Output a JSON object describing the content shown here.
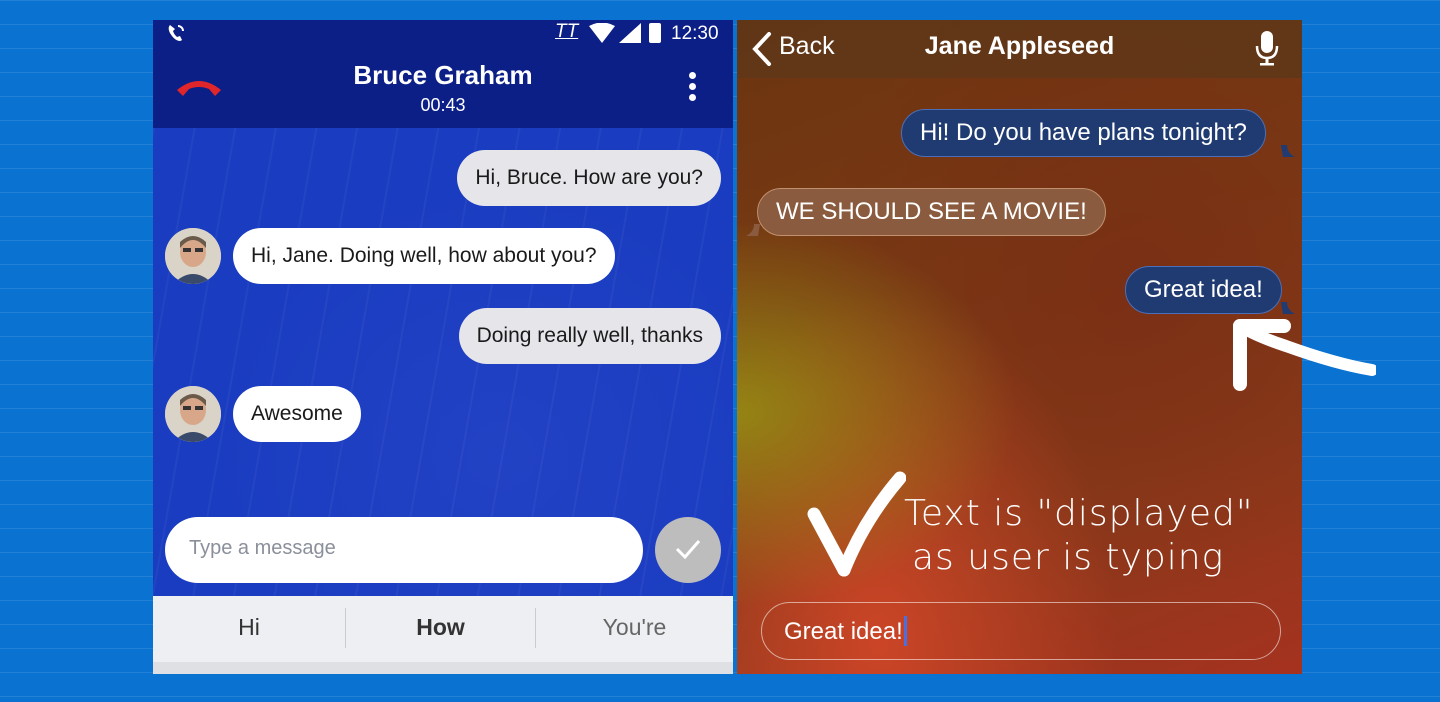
{
  "left_phone": {
    "status_bar": {
      "time": "12:30",
      "tty_label": "TT"
    },
    "call": {
      "caller_name": "Bruce Graham",
      "timer": "00:43"
    },
    "messages": [
      {
        "from": "me",
        "text": "Hi, Bruce. How are you?"
      },
      {
        "from": "them",
        "text": "Hi, Jane. Doing well, how about you?"
      },
      {
        "from": "me",
        "text": "Doing really well, thanks"
      },
      {
        "from": "them",
        "text": "Awesome"
      }
    ],
    "composer": {
      "placeholder": "Type a message"
    },
    "suggestions": [
      "Hi",
      "How",
      "You're"
    ]
  },
  "right_phone": {
    "header": {
      "back_label": "Back",
      "contact_name": "Jane Appleseed"
    },
    "messages": [
      {
        "from": "me",
        "text": "Hi! Do you have plans tonight?"
      },
      {
        "from": "them",
        "text": "WE SHOULD SEE A MOVIE!"
      },
      {
        "from": "me",
        "text": "Great idea!"
      }
    ],
    "input": {
      "value": "Great idea!"
    }
  },
  "annotation": {
    "line1": "Text is \"displayed\"",
    "line2": "as user is typing"
  },
  "colors": {
    "page_background": "#0a72d0",
    "android_header": "#0b1f86",
    "android_chat_bg": "#1a3cc0",
    "hangup_red": "#e0262b",
    "ios_sent_bubble": "#1f3b72",
    "ios_received_bubble": "#8a5b3e"
  },
  "icons": [
    "call-status-icon",
    "tty-icon",
    "wifi-icon",
    "signal-icon",
    "battery-icon",
    "hangup-icon",
    "overflow-menu-icon",
    "check-icon",
    "back-chevron-icon",
    "microphone-icon",
    "arrow-annotation-icon"
  ]
}
